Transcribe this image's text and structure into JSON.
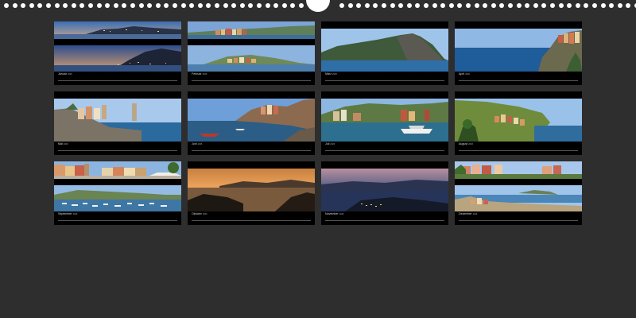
{
  "calendar": {
    "months": [
      {
        "name": "Januar",
        "year": "2026",
        "layout": "split",
        "image": "harbor-castle-dusk-panorama"
      },
      {
        "name": "Februar",
        "year": "2026",
        "layout": "split",
        "image": "colorful-village-waterfront"
      },
      {
        "name": "März",
        "year": "2026",
        "layout": "single",
        "image": "rocky-island-headland"
      },
      {
        "name": "April",
        "year": "2026",
        "layout": "single",
        "image": "cliff-village-sea"
      },
      {
        "name": "Mai",
        "year": "2026",
        "layout": "single",
        "image": "church-on-rocks"
      },
      {
        "name": "Juni",
        "year": "2026",
        "layout": "single",
        "image": "harbor-boats-cliffs"
      },
      {
        "name": "Juli",
        "year": "2026",
        "layout": "single",
        "image": "village-harbor-ferries"
      },
      {
        "name": "August",
        "year": "2026",
        "layout": "single",
        "image": "terraced-hillside-village"
      },
      {
        "name": "September",
        "year": "2026",
        "layout": "split",
        "image": "piazza-and-marina"
      },
      {
        "name": "Oktober",
        "year": "2026",
        "layout": "single",
        "image": "sunset-over-bay"
      },
      {
        "name": "November",
        "year": "2026",
        "layout": "single",
        "image": "bay-at-twilight"
      },
      {
        "name": "Dezember",
        "year": "2026",
        "layout": "split",
        "image": "hill-town-and-beach"
      }
    ],
    "day_count": 31
  },
  "colors": {
    "background": "#2e2e2e",
    "page": "#000000",
    "binding": "#ffffff"
  }
}
